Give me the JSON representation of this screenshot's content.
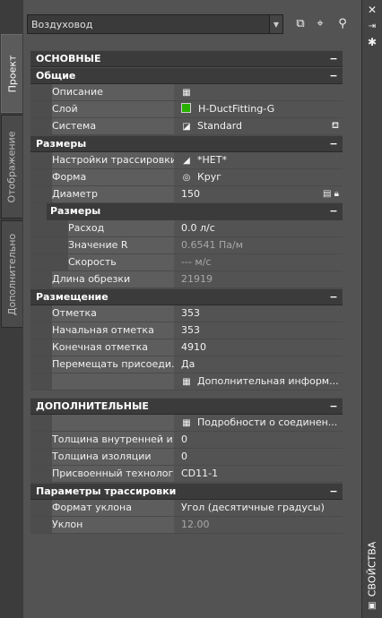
{
  "tabs": {
    "project": "Проект",
    "display": "Отображение",
    "extra": "Дополнительно"
  },
  "panel_title": "СВОЙСТВА",
  "toolbar": {
    "dropdown_value": "Воздуховод"
  },
  "sections": {
    "basic": "ОСНОВНЫЕ",
    "general": "Общие",
    "description": {
      "label": "Описание",
      "value": ""
    },
    "layer": {
      "label": "Слой",
      "value": "H-DuctFitting-G"
    },
    "system": {
      "label": "Система",
      "value": "Standard"
    },
    "sizes": "Размеры",
    "routing_settings": {
      "label": "Настройки трассировки",
      "value": "*НЕТ*"
    },
    "shape": {
      "label": "Форма",
      "value": "Круг"
    },
    "diameter": {
      "label": "Диаметр",
      "value": "150"
    },
    "sizes_sub": "Размеры",
    "flow": {
      "label": "Расход",
      "value": "0.0 л/с"
    },
    "r_value": {
      "label": "Значение R",
      "value": "0.6541 Па/м"
    },
    "velocity": {
      "label": "Скорость",
      "value": "--- м/с"
    },
    "cut_length": {
      "label": "Длина обрезки",
      "value": "21919"
    },
    "placement": "Размещение",
    "elevation": {
      "label": "Отметка",
      "value": "353"
    },
    "start_elev": {
      "label": "Начальная отметка",
      "value": "353"
    },
    "end_elev": {
      "label": "Конечная отметка",
      "value": "4910"
    },
    "move_attached": {
      "label": "Перемещать присоеди...",
      "value": "Да"
    },
    "more_info": {
      "value": "Дополнительная информ..."
    },
    "additional": "ДОПОЛНИТЕЛЬНЫЕ",
    "connection_details": {
      "value": "Подробности о соединен..."
    },
    "inner_thickness": {
      "label": "Толщина внутренней и...",
      "value": "0"
    },
    "insulation": {
      "label": "Толщина изоляции",
      "value": "0"
    },
    "tech": {
      "label": "Присвоенный технолог...",
      "value": "CD11-1"
    },
    "routing_params": "Параметры трассировки",
    "slope_format": {
      "label": "Формат уклона",
      "value": "Угол (десятичные градусы)"
    },
    "slope": {
      "label": "Уклон",
      "value": "12.00"
    }
  }
}
